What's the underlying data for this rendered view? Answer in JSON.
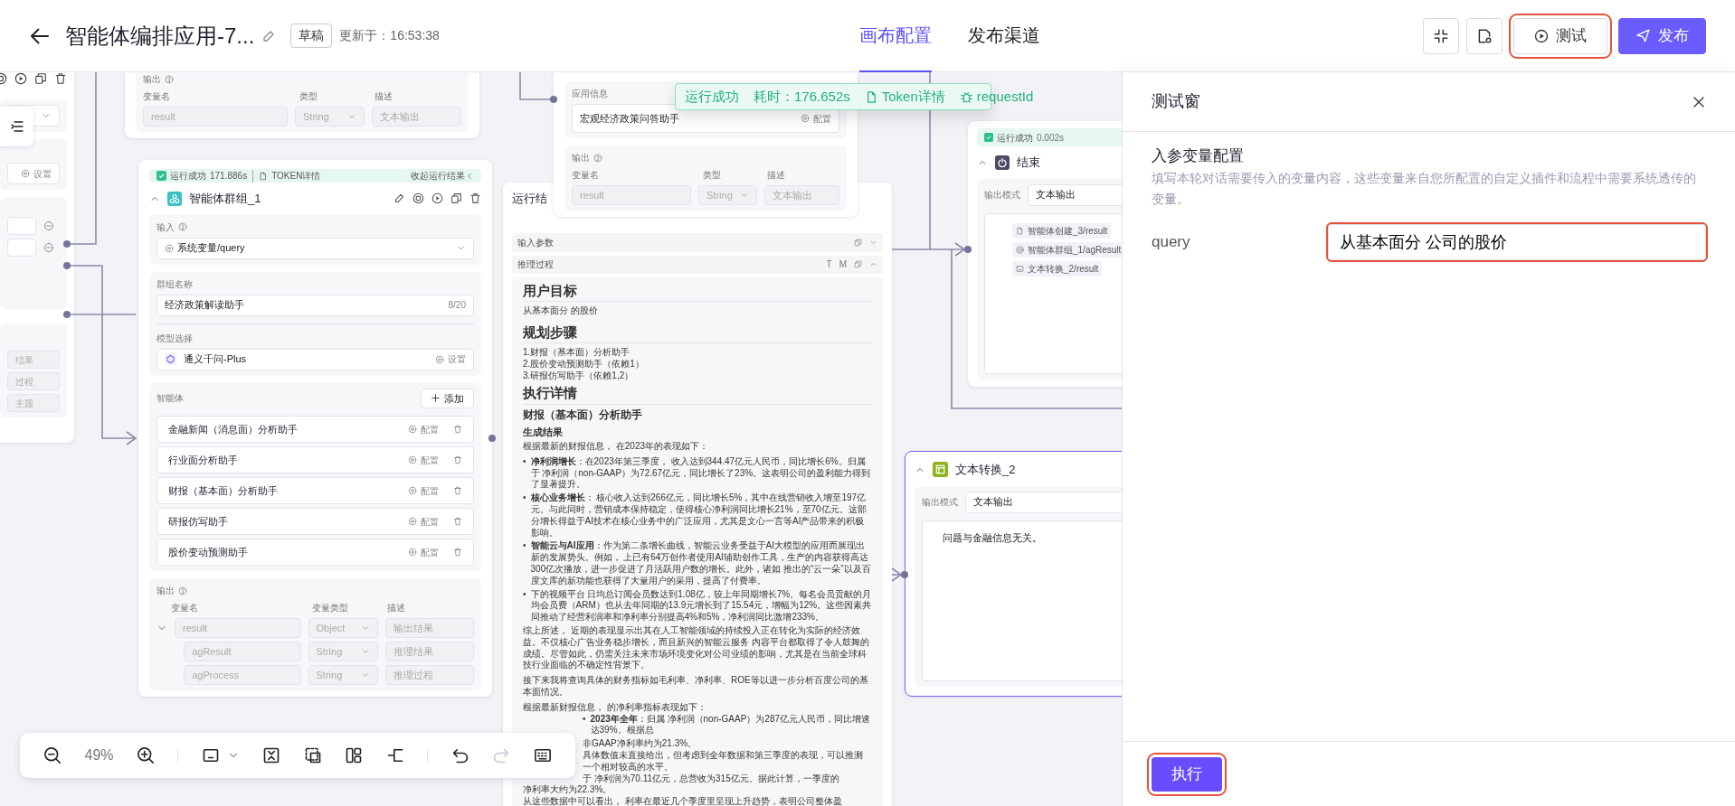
{
  "header": {
    "title": "智能体编排应用-7...",
    "badge": "草稿",
    "updated": "更新于：16:53:38",
    "tabs": [
      {
        "label": "画布配置",
        "selected": true
      },
      {
        "label": "发布渠道",
        "selected": false
      }
    ],
    "actions": [
      {
        "kind": "test",
        "label": "测试",
        "highlighted": true
      },
      {
        "kind": "primary",
        "label": "发布",
        "highlighted": false
      }
    ]
  },
  "canvas": {
    "toast": {
      "status": "运行成功",
      "time": "耗时：176.652s",
      "token": "Token详情",
      "request": "requestId"
    },
    "left_node": {
      "setting": "设置",
      "outputs": [
        "结果",
        "过程",
        "主题"
      ]
    },
    "top_node": {
      "output_label": "输出",
      "columns": [
        "变量名",
        "类型",
        "描述"
      ],
      "row": {
        "name": "result",
        "type": "String",
        "desc": "文本输出"
      }
    },
    "group_node": {
      "run": {
        "status": "运行成功",
        "time": "171.886s",
        "token": "TOKEN详情",
        "collapse": "收起运行结果"
      },
      "title": "智能体群组_1",
      "input_label": "输入",
      "input_value": "系统变量/query",
      "name_label": "群组名称",
      "name_value": "经济政策解读助手",
      "name_count": "8/20",
      "model_label": "模型选择",
      "model_value": "通义千问-Plus",
      "model_action": "设置",
      "agents_label": "智能体",
      "add_label": "添加",
      "agents": [
        {
          "name": "金融新闻（消息面）分析助手",
          "action": "配置"
        },
        {
          "name": "行业面分析助手",
          "action": "配置"
        },
        {
          "name": "财报（基本面）分析助手",
          "action": "配置"
        },
        {
          "name": "研报仿写助手",
          "action": "配置"
        },
        {
          "name": "股价变动预测助手",
          "action": "配置"
        }
      ],
      "output_label": "输出",
      "columns": [
        "变量名",
        "变量类型",
        "描述"
      ],
      "outputs": [
        {
          "name": "result",
          "type": "Object",
          "desc": "输出结果",
          "expanded": true,
          "children": [
            {
              "name": "agResult",
              "type": "String",
              "desc": "推理结果"
            },
            {
              "name": "agProcess",
              "type": "String",
              "desc": "推理过程"
            }
          ]
        }
      ]
    },
    "app_node": {
      "label": "应用信息",
      "value": "宏观经济政策问答助手",
      "action": "配置",
      "output_label": "输出",
      "columns": [
        "变量名",
        "类型",
        "描述"
      ],
      "row": {
        "name": "result",
        "type": "String",
        "desc": "文本输出"
      }
    },
    "result_panel": {
      "title": "运行结",
      "sections": [
        {
          "label": "输入参数",
          "expanded": false
        },
        {
          "label": "推理过程",
          "expanded": true,
          "tools": [
            "T",
            "M"
          ]
        }
      ],
      "blocks": [
        {
          "kind": "h1",
          "text": "用户目标"
        },
        {
          "kind": "p",
          "text": "从基本面分 的股价"
        },
        {
          "kind": "h1",
          "text": "规划步骤"
        },
        {
          "kind": "line",
          "text": "1.财报（基本面）分析助手"
        },
        {
          "kind": "line",
          "text": "2.股价变动预测助手（依赖1）"
        },
        {
          "kind": "line",
          "text": "3.研报仿写助手（依赖1,2）"
        },
        {
          "kind": "h1",
          "text": "执行详情"
        },
        {
          "kind": "h2",
          "text": "财报（基本面）分析助手"
        },
        {
          "kind": "h3",
          "text": "生成结果"
        },
        {
          "kind": "p",
          "text": "根据最新的财报信息， 在2023年的表现如下："
        },
        {
          "kind": "bullet",
          "marker": "•",
          "text": "**净利润增长**：在2023年第三季度， 收入达到344.47亿元人民币，同比增长6%。归属于 净利润（non-GAAP）为72.67亿元，同比增长了23%。这表明公司的盈利能力得到了显著提升。"
        },
        {
          "kind": "bullet",
          "marker": "•",
          "text": "**核心业务增长**： 核心收入达到266亿元，同比增长5%，其中在线营销收入增至197亿元。与此同时，营销成本保持稳定，使得核心净利润同比增长21%，至70亿元。这部分增长得益于AI技术在核心业务中的广泛应用，尤其是文心一言等AI产品带来的积极影响。"
        },
        {
          "kind": "bullet",
          "marker": "•",
          "text": "**智能云与AI应用**：作为第二条增长曲线，智能云业务受益于AI大模型的应用而展现出新的发展势头。例如， 上已有64万创作者使用AI辅助创作工具，生产的内容获得高达300亿次播放，进一步促进了月活跃用户数的增长。此外，诸如 推出的“云一朵”以及百度文库的新功能也获得了大量用户的采用，提高了付费率。"
        },
        {
          "kind": "bullet",
          "marker": "•",
          "text": " 下的视频平台 日均总订阅会员数达到1.08亿，较上年同期增长7%。每名会员贡献的月均会员费（ARM）也从去年同期的13.9元增长到了15.54元，增幅为12%。这些因素共同推动了经营利润率和净利率分别提高4%和5%，净利润同比激增233%。"
        },
        {
          "kind": "p",
          "text": "综上所述， 近期的表现显示出其在人工智能领域的持续投入正在转化为实际的经济效益。不仅核心广告业务稳步增长，而且新兴的智能云服务 内容平台都取得了令人鼓舞的成绩。尽管如此，仍需关注未来市场环境变化对公司业绩的影响，尤其是在当前全球科技行业面临的不确定性背景下。"
        },
        {
          "kind": "p",
          "text": "接下来我将查询具体的财务指标如毛利率、净利率、ROE等以进一步分析百度公司的基本面情况。"
        },
        {
          "kind": "line",
          "text": "根据最新财报信息， 的净利率指标表现如下："
        },
        {
          "kind": "bullet",
          "marker": "•",
          "text": "**2023年全年**：归属 净利润（non-GAAP）为287亿元人民币，同比增速达39%。根据总"
        },
        {
          "kind": "fragment",
          "text": "非GAAP净利率约为21.3%。"
        },
        {
          "kind": "fragment",
          "text": "具体数值未直接给出，但考虑到全年数据和第三季度的表现，可以推测"
        },
        {
          "kind": "fragment",
          "text": "一个相对较高的水平。"
        },
        {
          "kind": "fragment",
          "text": "于 净利润为70.11亿元，总营收为315亿元。据此计算，一季度的"
        },
        {
          "kind": "line",
          "text": "净利率大约为22.3%。"
        },
        {
          "kind": "line",
          "text": "从这些数据中可以看出， 利率在最近几个季度里呈现上升趋势，表明公司整体盈"
        }
      ]
    },
    "end_node": {
      "run": {
        "status": "运行成功",
        "time": "0.002s"
      },
      "title": "结束",
      "mode_label": "输出模式",
      "mode_value": "文本输出",
      "refs": [
        "智能体创建_3/result",
        "智能体群组_1/agResult",
        "文本转换_2/result"
      ]
    },
    "text_node": {
      "title": "文本转换_2",
      "selected": true,
      "mode_label": "输出模式",
      "mode_value": "文本输出",
      "content": "问题与金融信息无关。"
    },
    "toolbar": {
      "zoom": "49%",
      "redo_disabled": true
    }
  },
  "test_panel": {
    "title": "测试窗",
    "section": "入参变量配置",
    "description": "填写本轮对话需要传入的变量内容，这些变量来自您所配置的自定义插件和流程中需要系统透传的变量。",
    "vars": [
      {
        "name": "query",
        "value": "从基本面分 公司的股价",
        "highlighted": true
      }
    ],
    "run_button": {
      "label": "执行",
      "highlighted": true
    }
  }
}
